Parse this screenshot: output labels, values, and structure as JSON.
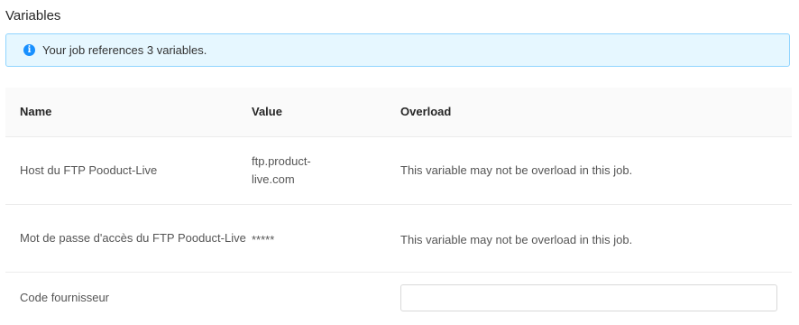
{
  "section": {
    "title": "Variables"
  },
  "banner": {
    "text": "Your job references 3 variables.",
    "icon": "info-icon",
    "color": "#1890ff"
  },
  "table": {
    "headers": {
      "name": "Name",
      "value": "Value",
      "overload": "Overload"
    },
    "rows": [
      {
        "name": "Host du FTP Pooduct-Live",
        "value": "ftp.product-live.com",
        "overload": "This variable may not be overload in this job."
      },
      {
        "name": "Mot de passe d'accès du FTP Pooduct-Live",
        "value": "*****",
        "overload": "This variable may not be overload in this job."
      },
      {
        "name": "Code fournisseur",
        "value": "",
        "overload_input_value": ""
      }
    ]
  }
}
